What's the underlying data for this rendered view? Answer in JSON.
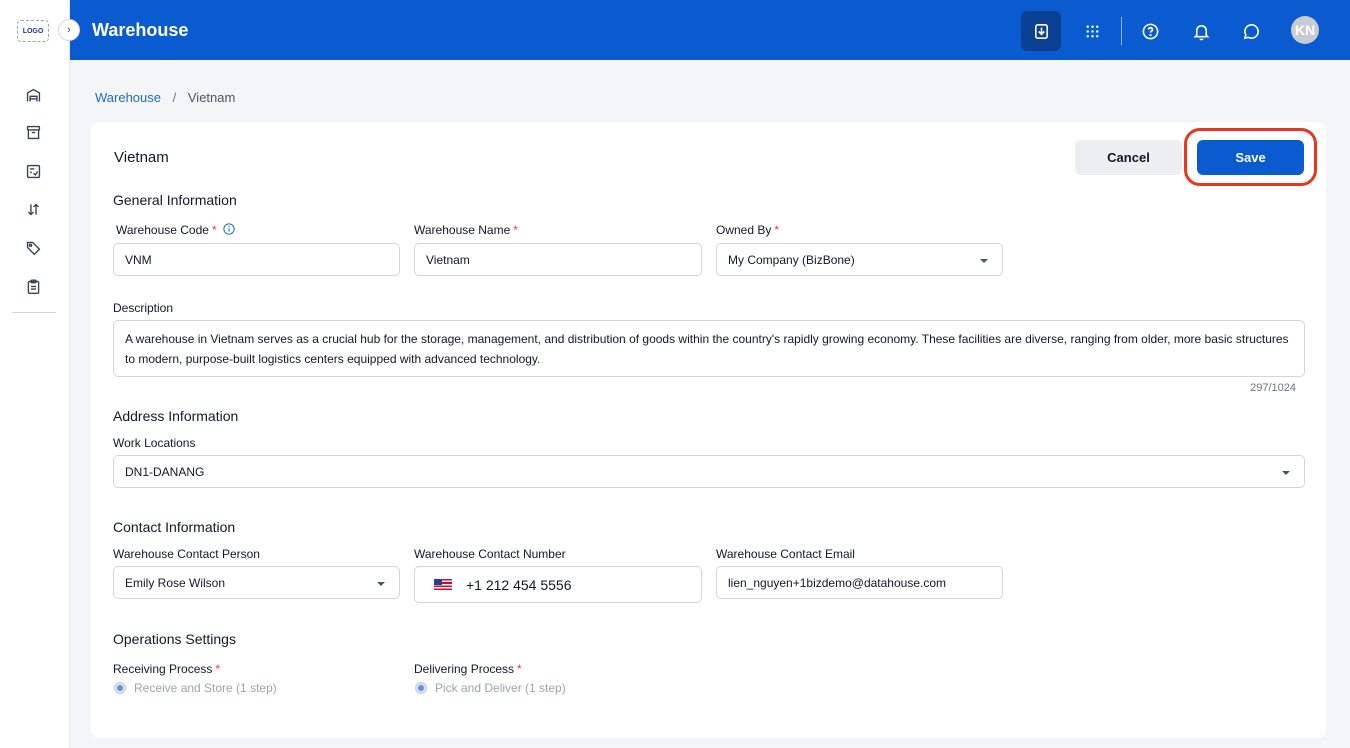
{
  "sidebar": {
    "logo_text": "LOGO",
    "items": [
      {
        "icon": "warehouse-icon"
      },
      {
        "icon": "archive-box-icon"
      },
      {
        "icon": "checklist-icon"
      },
      {
        "icon": "sort-arrows-icon"
      },
      {
        "icon": "tags-icon"
      },
      {
        "icon": "clipboard-icon"
      }
    ]
  },
  "header": {
    "title": "Warehouse",
    "icons": [
      "download-icon",
      "apps-grid-icon",
      "help-icon",
      "bell-icon",
      "chat-icon"
    ],
    "avatar_initials": "KN",
    "color": "#0a5bcf"
  },
  "breadcrumb": {
    "link": "Warehouse",
    "separator": "/",
    "current": "Vietnam"
  },
  "form": {
    "title": "Vietnam",
    "cancel_label": "Cancel",
    "save_label": "Save",
    "general_title": "General Information",
    "code_label": "Warehouse Code",
    "code_value": "VNM",
    "name_label": "Warehouse Name",
    "name_value": "Vietnam",
    "owned_label": "Owned By",
    "owned_value": "My Company (BizBone)",
    "required_mark": "*",
    "description_label": "Description",
    "description_value": "A warehouse in Vietnam serves as a crucial hub for the storage, management, and distribution of goods within the country's rapidly growing economy. These facilities are diverse, ranging from older, more basic structures to modern, purpose-built logistics centers equipped with advanced technology.",
    "description_counter": "297/1024",
    "address_title": "Address Information",
    "work_locations_label": "Work Locations",
    "work_locations_value": "DN1-DANANG",
    "contact_title": "Contact Information",
    "contact_person_label": "Warehouse Contact Person",
    "contact_person_value": "Emily Rose Wilson",
    "contact_number_label": "Warehouse Contact Number",
    "contact_number_value": "+1 212 454 5556",
    "contact_email_label": "Warehouse Contact Email",
    "contact_email_value": "lien_nguyen+1bizdemo@datahouse.com",
    "operations_title": "Operations Settings",
    "receiving_label": "Receiving Process",
    "receiving_value": "Receive and Store (1 step)",
    "delivering_label": "Delivering Process",
    "delivering_value": "Pick and Deliver (1 step)",
    "highlight_color": "#e8361e"
  }
}
